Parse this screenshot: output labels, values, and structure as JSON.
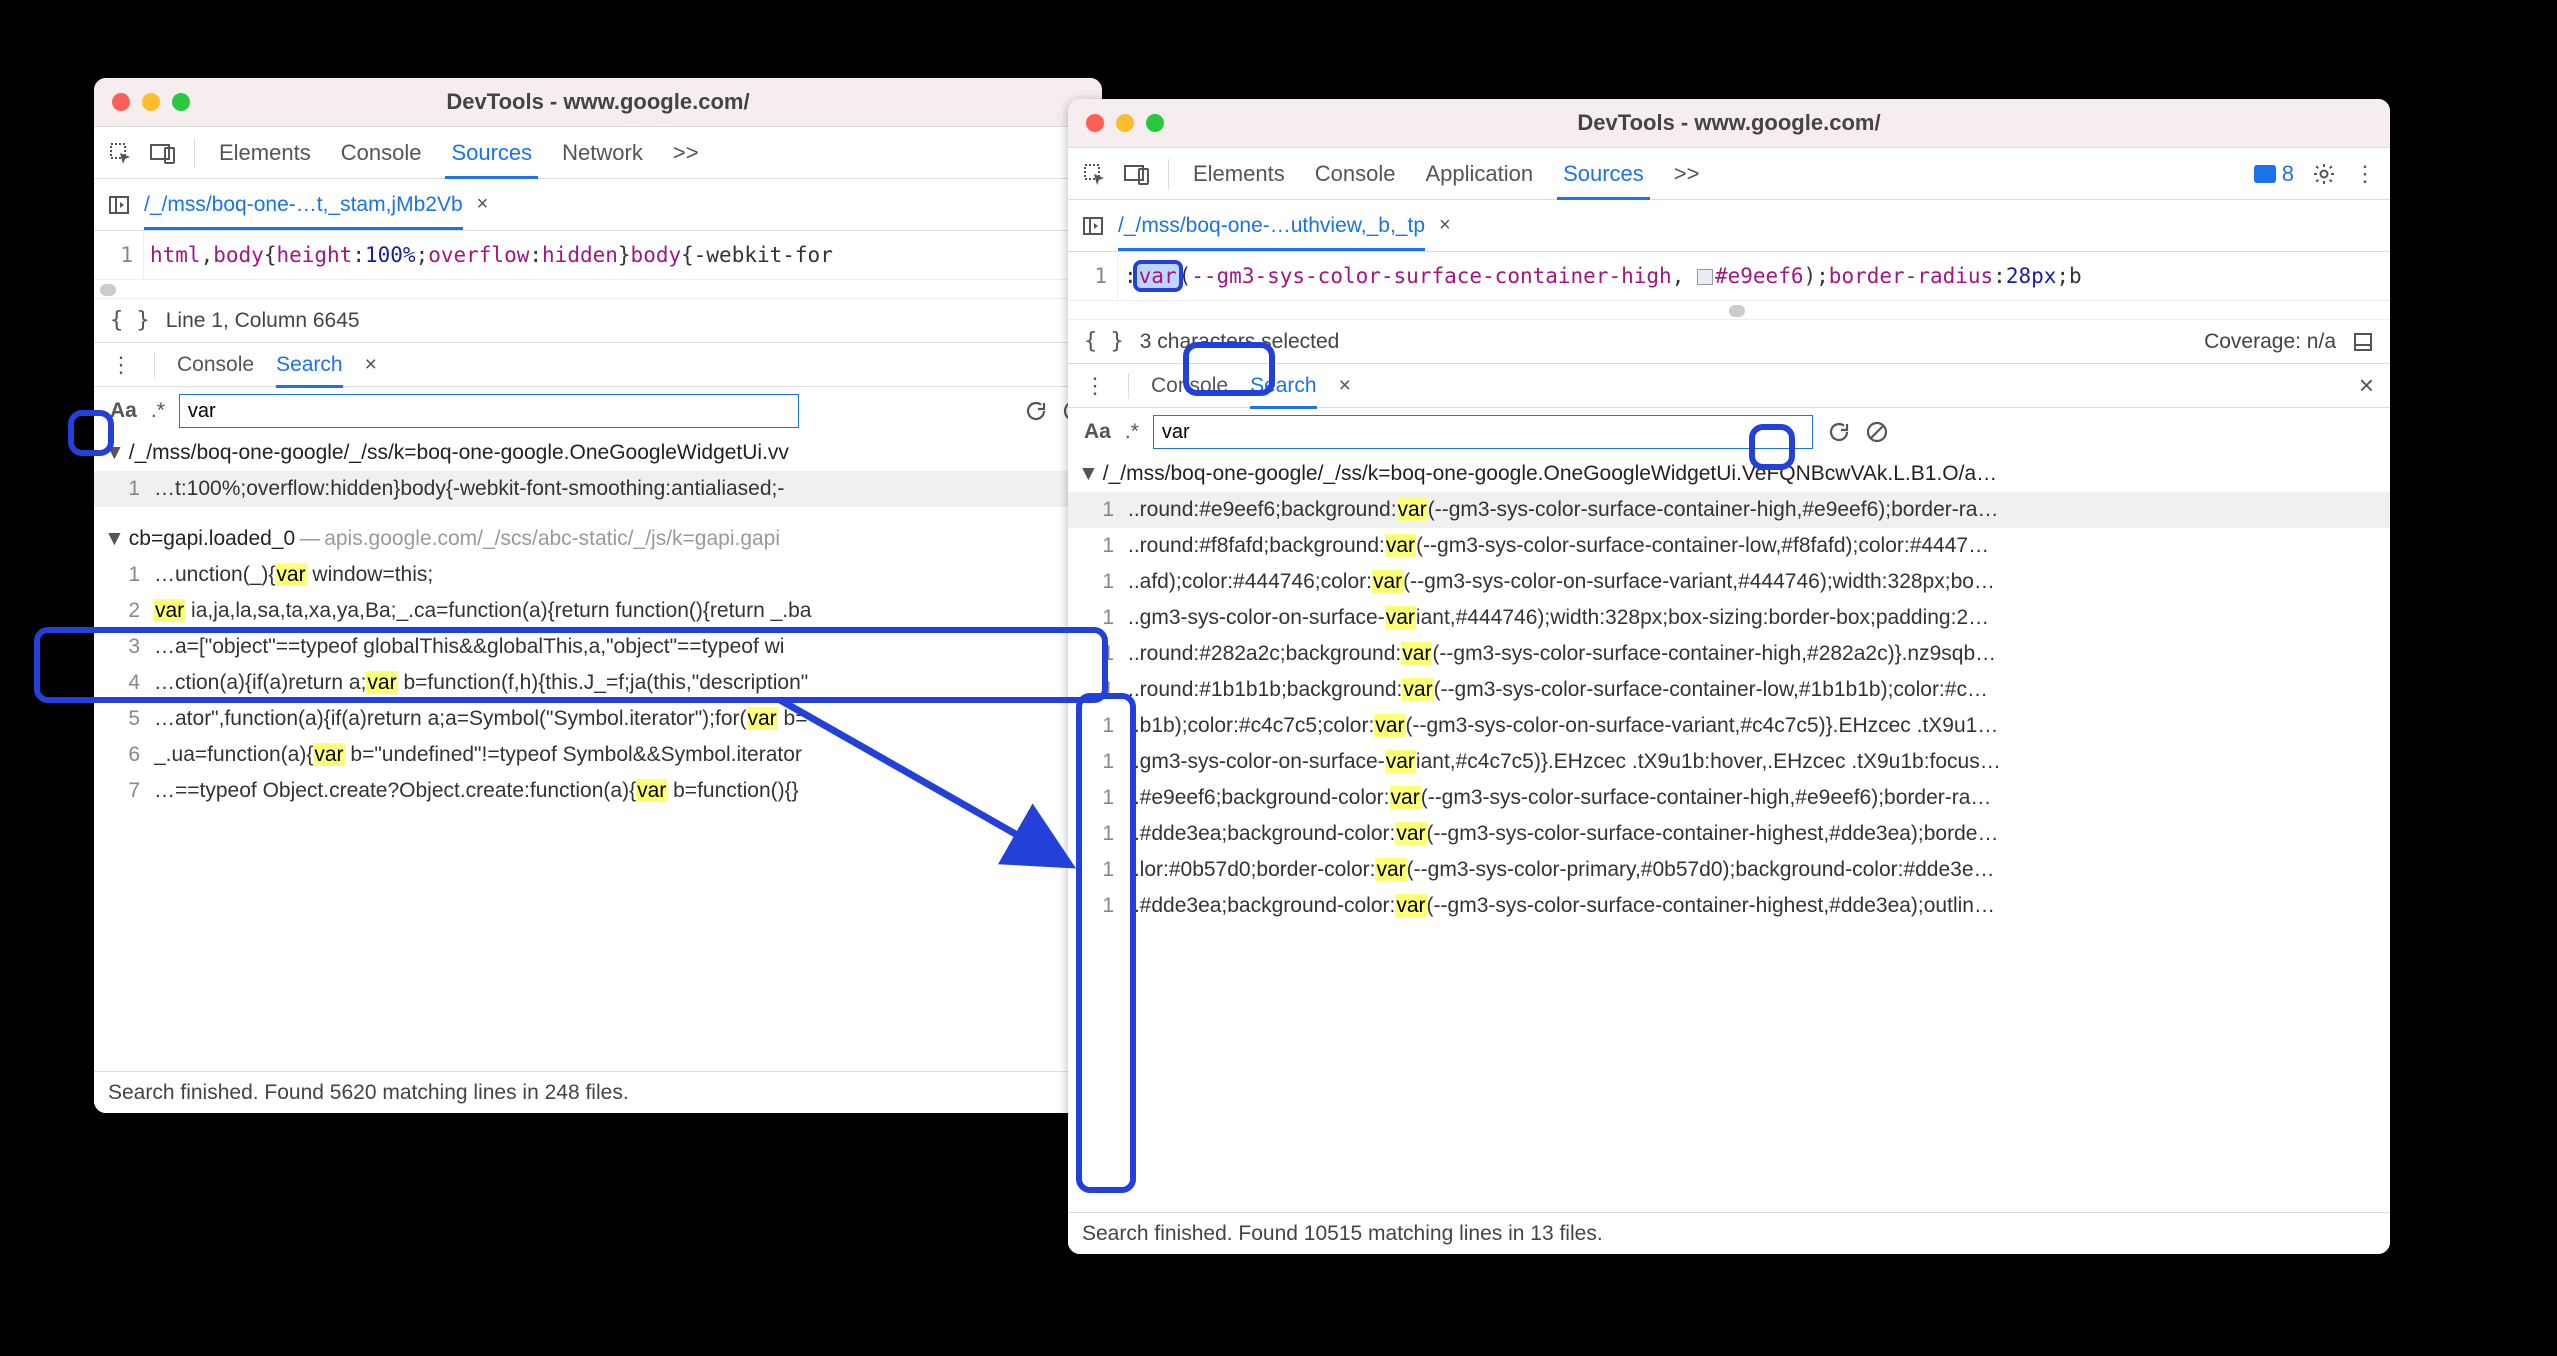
{
  "left": {
    "title": "DevTools - www.google.com/",
    "tabs": {
      "elements": "Elements",
      "console": "Console",
      "sources": "Sources",
      "network": "Network"
    },
    "filename": "/_/mss/boq-one-…t,_stam,jMb2Vb",
    "code": {
      "ln": "1",
      "p1": "html",
      "p2": ",",
      "p3": "body",
      "p4": "{",
      "p5": "height",
      "p6": ":",
      "p7": "100%",
      "p8": ";",
      "p9": "overflow",
      "p10": ":",
      "p11": "hidden",
      "p12": "}",
      "p13": "body",
      "p14": "{-webkit-for"
    },
    "status": "Line 1, Column 6645",
    "drawer": {
      "console": "Console",
      "search": "Search"
    },
    "search_value": "var",
    "results": {
      "file1": "/_/mss/boq-one-google/_/ss/k=boq-one-google.OneGoogleWidgetUi.vv",
      "r1": {
        "n": "1",
        "pre": "…t:100%;overflow:hidden}body{-webkit-font-smoothing:antialiased;-"
      },
      "file2a": "cb=gapi.loaded_0",
      "file2_dash": " — ",
      "file2b": "apis.google.com/_/scs/abc-static/_/js/k=gapi.gapi",
      "rows": [
        {
          "n": "1",
          "a": "…unction(_){",
          "b": "var",
          "c": " window=this;"
        },
        {
          "n": "2",
          "a": "",
          "b": "var",
          "c": " ia,ja,la,sa,ta,xa,ya,Ba;_.ca=function(a){return function(){return _.ba"
        },
        {
          "n": "3",
          "a": "…a=[\"object\"==typeof globalThis&&globalThis,a,\"object\"==typeof wi",
          "b": "",
          "c": ""
        },
        {
          "n": "4",
          "a": "…ction(a){if(a)return a;",
          "b": "var",
          "c": " b=function(f,h){this.J_=f;ja(this,\"description\""
        },
        {
          "n": "5",
          "a": "…ator\",function(a){if(a)return a;a=Symbol(\"Symbol.iterator\");for(",
          "b": "var",
          "c": " b="
        },
        {
          "n": "6",
          "a": "_.ua=function(a){",
          "b": "var",
          "c": " b=\"undefined\"!=typeof Symbol&&Symbol.iterator"
        },
        {
          "n": "7",
          "a": "…==typeof Object.create?Object.create:function(a){",
          "b": "var",
          "c": " b=function(){}"
        }
      ]
    },
    "footer": "Search finished.  Found 5620 matching lines in 248 files."
  },
  "right": {
    "title": "DevTools - www.google.com/",
    "tabs": {
      "elements": "Elements",
      "console": "Console",
      "application": "Application",
      "sources": "Sources"
    },
    "msg_count": "8",
    "filename": "/_/mss/boq-one-…uthview,_b,_tp",
    "code": {
      "ln": "1",
      "p0": ":",
      "p1": "var",
      "p2": "(",
      "p3": "--gm3-sys-color-surface-container-high",
      "p4": ", ",
      "p5": "#e9eef6",
      "p6": ");",
      "p7": "border-radius",
      "p8": ":",
      "p9": "28px",
      "p10": ";b"
    },
    "status": "3 characters selected",
    "coverage": "Coverage: n/a",
    "drawer": {
      "console": "Console",
      "search": "Search"
    },
    "search_value": "var",
    "results": {
      "file1": "/_/mss/boq-one-google/_/ss/k=boq-one-google.OneGoogleWidgetUi.VeFQNBcwVAk.L.B1.O/a…",
      "rows": [
        {
          "a": "..round:#e9eef6;background:",
          "b": "var",
          "c": "(--gm3-sys-color-surface-container-high,#e9eef6);border-ra…"
        },
        {
          "a": "..round:#f8fafd;background:",
          "b": "var",
          "c": "(--gm3-sys-color-surface-container-low,#f8fafd);color:#4447…"
        },
        {
          "a": "..afd);color:#444746;color:",
          "b": "var",
          "c": "(--gm3-sys-color-on-surface-variant,#444746);width:328px;bo…"
        },
        {
          "a": "..gm3-sys-color-on-surface-",
          "b": "var",
          "c": "iant,#444746);width:328px;box-sizing:border-box;padding:2…"
        },
        {
          "a": "..round:#282a2c;background:",
          "b": "var",
          "c": "(--gm3-sys-color-surface-container-high,#282a2c)}.nz9sqb…"
        },
        {
          "a": "..round:#1b1b1b;background:",
          "b": "var",
          "c": "(--gm3-sys-color-surface-container-low,#1b1b1b);color:#c…"
        },
        {
          "a": "..b1b);color:#c4c7c5;color:",
          "b": "var",
          "c": "(--gm3-sys-color-on-surface-variant,#c4c7c5)}.EHzcec .tX9u1…"
        },
        {
          "a": "..gm3-sys-color-on-surface-",
          "b": "var",
          "c": "iant,#c4c7c5)}.EHzcec .tX9u1b:hover,.EHzcec .tX9u1b:focus…"
        },
        {
          "a": "..#e9eef6;background-color:",
          "b": "var",
          "c": "(--gm3-sys-color-surface-container-high,#e9eef6);border-ra…"
        },
        {
          "a": "..#dde3ea;background-color:",
          "b": "var",
          "c": "(--gm3-sys-color-surface-container-highest,#dde3ea);borde…"
        },
        {
          "a": "..lor:#0b57d0;border-color:",
          "b": "var",
          "c": "(--gm3-sys-color-primary,#0b57d0);background-color:#dde3e…"
        },
        {
          "a": "..#dde3ea;background-color:",
          "b": "var",
          "c": "(--gm3-sys-color-surface-container-highest,#dde3ea);outlin…"
        }
      ]
    },
    "footer": "Search finished.  Found 10515 matching lines in 13 files."
  },
  "labels": {
    "aa": "Aa",
    "regex": ".*",
    "more_tabs": ">>",
    "close": "×",
    "triangle": "▼",
    "kebab": "⋮",
    "one": "1"
  }
}
